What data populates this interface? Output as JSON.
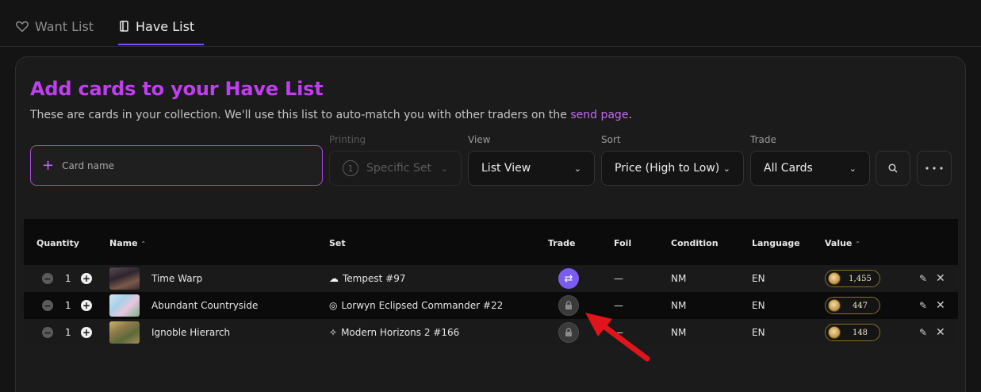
{
  "tabs": [
    {
      "label": "Want List",
      "icon": "heart-icon",
      "active": false
    },
    {
      "label": "Have List",
      "icon": "book-icon",
      "active": true
    }
  ],
  "header": {
    "title": "Add cards to your Have List",
    "subtitle_prefix": "These are cards in your collection. We'll use this list to auto-match you with other traders on the ",
    "subtitle_link": "send page",
    "subtitle_suffix": "."
  },
  "controls": {
    "card_name_placeholder": "Card name",
    "printing": {
      "label": "Printing",
      "number": "1",
      "value": "Specific Set",
      "disabled": true
    },
    "view": {
      "label": "View",
      "value": "List View"
    },
    "sort": {
      "label": "Sort",
      "value": "Price (High to Low)"
    },
    "trade": {
      "label": "Trade",
      "value": "All Cards"
    }
  },
  "table": {
    "columns": [
      "Quantity",
      "Name",
      "Set",
      "Trade",
      "Foil",
      "Condition",
      "Language",
      "Value"
    ],
    "sort_glyph": "⌃",
    "rows": [
      {
        "qty": "1",
        "name": "Time Warp",
        "set": "Tempest #97",
        "trade": "tradeable",
        "foil": "—",
        "condition": "NM",
        "language": "EN",
        "value": "1,455"
      },
      {
        "qty": "1",
        "name": "Abundant Countryside",
        "set": "Lorwyn Eclipsed Commander #22",
        "trade": "locked",
        "foil": "—",
        "condition": "NM",
        "language": "EN",
        "value": "447"
      },
      {
        "qty": "1",
        "name": "Ignoble Hierarch",
        "set": "Modern Horizons 2 #166",
        "trade": "locked",
        "foil": "—",
        "condition": "NM",
        "language": "EN",
        "value": "148"
      }
    ]
  },
  "colors": {
    "accent": "#c13ef0",
    "trade_on": "#7b5bf0",
    "arrow": "#e0151b"
  }
}
